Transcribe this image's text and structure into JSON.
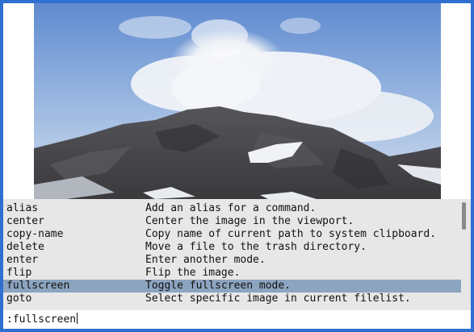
{
  "viewer": {
    "image": {
      "subject": "mountain-peak-with-cloud",
      "sky_top_color": "#5c8ad0",
      "sky_bottom_color": "#c9d8ec",
      "cloud_color": "#f4f4f4",
      "rock_color": "#4a4a4a",
      "snow_color": "#f0f2f4"
    }
  },
  "completion": {
    "selected_index": 6,
    "selected_color": "#8ca4bf",
    "background_color": "#e7e7e7",
    "items": [
      {
        "command": "alias",
        "description": "Add an alias for a command."
      },
      {
        "command": "center",
        "description": "Center the image in the viewport."
      },
      {
        "command": "copy-name",
        "description": "Copy name of current path to system clipboard."
      },
      {
        "command": "delete",
        "description": "Move a file to the trash directory."
      },
      {
        "command": "enter",
        "description": "Enter another mode."
      },
      {
        "command": "flip",
        "description": "Flip the image."
      },
      {
        "command": "fullscreen",
        "description": "Toggle fullscreen mode."
      },
      {
        "command": "goto",
        "description": "Select specific image in current filelist."
      }
    ]
  },
  "commandline": {
    "text": ":fullscreen"
  },
  "window": {
    "border_color": "#2f6fcf"
  }
}
